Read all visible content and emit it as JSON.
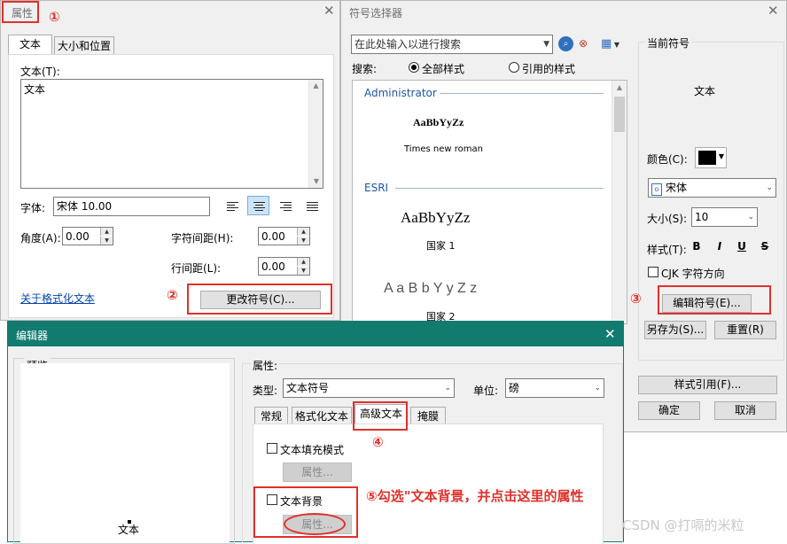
{
  "left_dialog": {
    "title": "属性",
    "tabs": [
      "文本",
      "大小和位置"
    ],
    "text_label": "文本(T):",
    "text_value": "文本",
    "font_label": "字体:",
    "font_value": "宋体 10.00",
    "angle_label": "角度(A):",
    "angle_value": "0.00",
    "char_spacing_label": "字符间距(H):",
    "char_spacing_value": "0.00",
    "line_spacing_label": "行间距(L):",
    "line_spacing_value": "0.00",
    "format_link": "关于格式化文本",
    "change_symbol_button": "更改符号(C)..."
  },
  "symbol_selector": {
    "title": "符号选择器",
    "search_placeholder": "在此处输入以进行搜索",
    "search_label": "搜索:",
    "radio_all": "全部样式",
    "radio_ref": "引用的样式",
    "groups": [
      {
        "name": "Administrator",
        "items": [
          {
            "sample": "AaBbYyZz",
            "caption": "Times new roman"
          }
        ]
      },
      {
        "name": "ESRI",
        "items": [
          {
            "sample": "AaBbYyZz",
            "caption": "国家 1"
          },
          {
            "sample": "A a B b Y y Z z",
            "caption": "国家 2"
          }
        ]
      }
    ],
    "current_symbol_label": "当前符号",
    "preview_text": "文本",
    "color_label": "颜色(C):",
    "color_value": "#000000",
    "font_value": "宋体",
    "size_label": "大小(S):",
    "size_value": "10",
    "style_label": "样式(T):",
    "style_buttons": [
      "B",
      "I",
      "U",
      "S"
    ],
    "cjk_label": "CJK 字符方向",
    "edit_symbol_button": "编辑符号(E)...",
    "save_as_button": "另存为(S)...",
    "reset_button": "重置(R)",
    "style_ref_button": "样式引用(F)...",
    "ok_button": "确定",
    "cancel_button": "取消"
  },
  "editor": {
    "title": "编辑器",
    "preview_label": "预览",
    "preview_text": "文本",
    "properties_label": "属性:",
    "type_label": "类型:",
    "type_value": "文本符号",
    "unit_label": "单位:",
    "unit_value": "磅",
    "tabs": [
      "常规",
      "格式化文本",
      "高级文本",
      "掩膜"
    ],
    "fill_mode_label": "文本填充模式",
    "properties_button_1": "属性...",
    "background_label": "文本背景",
    "properties_button_2": "属性..."
  },
  "annotations": {
    "n1": "①",
    "n2": "②",
    "n3": "③",
    "n4": "④",
    "n5_text": "⑤勾选\"文本背景，并点击这里的属性",
    "watermark": "CSDN @打嗝的米粒",
    "accent": "#e0312b"
  },
  "colors": {
    "editor_titlebar": "#117b6f",
    "link": "#0645ad",
    "section": "#1f56a4"
  }
}
